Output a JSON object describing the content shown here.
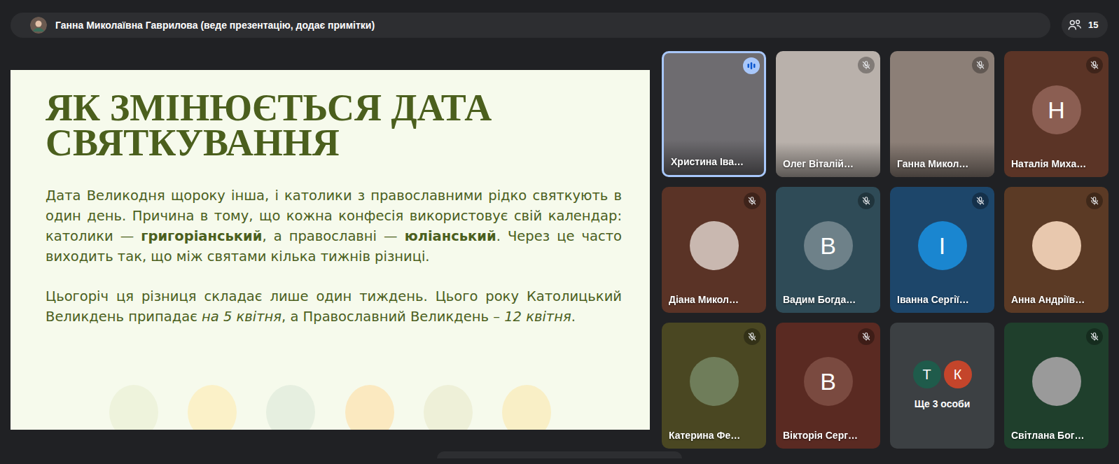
{
  "presenter_bar": {
    "text": "Ганна Миколаївна Гаврилова (веде презентацію, додає примітки)"
  },
  "participants_count": "15",
  "slide": {
    "title": "ЯК ЗМІНЮЄТЬСЯ ДАТА СВЯТКУВАННЯ",
    "paragraphs": [
      [
        {
          "text": "Дата Великодня щороку інша, і католики з православними рідко святкують в один день. Причина в тому, що кожна конфесія використовує свій календар: католики — ",
          "kind": "normal"
        },
        {
          "text": "григоріанський",
          "kind": "bold"
        },
        {
          "text": ", а православні — ",
          "kind": "normal"
        },
        {
          "text": "юліанський",
          "kind": "bold"
        },
        {
          "text": ". Через це часто виходить так, що між святами кілька тижнів різниці.",
          "kind": "normal"
        }
      ],
      [
        {
          "text": "Цьогоріч ця різниця складає лише один тиждень. Цього року Католицький Великдень припадає ",
          "kind": "normal"
        },
        {
          "text": "на 5 квітня",
          "kind": "italic"
        },
        {
          "text": ", а Православний Великдень – ",
          "kind": "normal"
        },
        {
          "text": "12 квітня",
          "kind": "italic"
        },
        {
          "text": ".",
          "kind": "normal"
        }
      ]
    ]
  },
  "tiles": [
    {
      "name": "Христина Іва…",
      "kind": "video",
      "muted": false,
      "speaking": true,
      "color": "#6e6c70"
    },
    {
      "name": "Олег Віталій…",
      "kind": "video",
      "muted": true,
      "speaking": false,
      "color": "#b9b1ab"
    },
    {
      "name": "Ганна Микол…",
      "kind": "video",
      "muted": true,
      "speaking": false,
      "color": "#8c7f77"
    },
    {
      "name": "Наталія Миха…",
      "kind": "letter",
      "letter": "Н",
      "avatar_color": "#8b5e52",
      "muted": true,
      "speaking": false,
      "color": "#5b3426"
    },
    {
      "name": "Діана Микол…",
      "kind": "photo",
      "avatar_color": "#c9b8b0",
      "muted": true,
      "speaking": false,
      "color": "#5a3326"
    },
    {
      "name": "Вадим Богда…",
      "kind": "letter",
      "letter": "В",
      "avatar_color": "#6e8189",
      "muted": true,
      "speaking": false,
      "color": "#2f4b57"
    },
    {
      "name": "Іванна Сергії…",
      "kind": "letter",
      "letter": "І",
      "avatar_color": "#1a86d0",
      "muted": true,
      "speaking": false,
      "color": "#1d466a"
    },
    {
      "name": "Анна Андріїв…",
      "kind": "photo",
      "avatar_color": "#e8c8ae",
      "muted": true,
      "speaking": false,
      "color": "#5b3a25"
    },
    {
      "name": "Катерина Фе…",
      "kind": "photo",
      "avatar_color": "#6f7d5a",
      "muted": true,
      "speaking": false,
      "color": "#4a4722"
    },
    {
      "name": "Вікторія Серг…",
      "kind": "letter",
      "letter": "В",
      "avatar_color": "#7a4a40",
      "muted": true,
      "speaking": false,
      "color": "#5a2a22"
    },
    {
      "name": "Ще 3 особи",
      "kind": "group",
      "members": [
        {
          "letter": "Т",
          "color": "#1f5b4b"
        },
        {
          "letter": "К",
          "color": "#c4452b"
        }
      ],
      "color": "#3c4043"
    },
    {
      "name": "Світлана Бог…",
      "kind": "photo",
      "avatar_color": "#9a9a9a",
      "muted": true,
      "speaking": false,
      "color": "#1f3f2c"
    }
  ]
}
